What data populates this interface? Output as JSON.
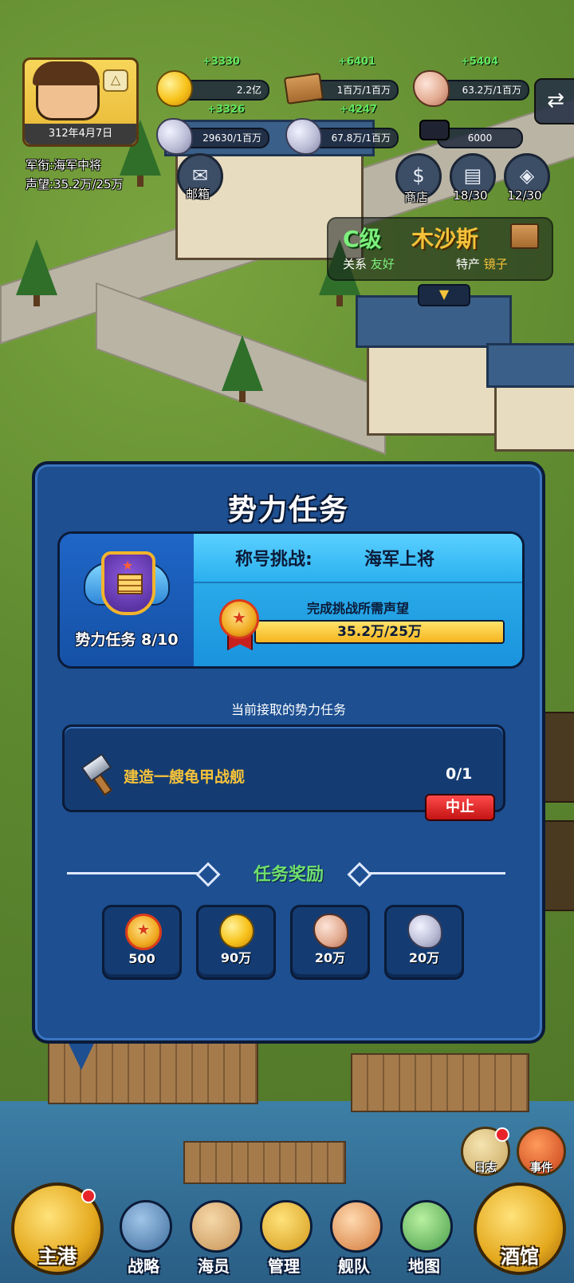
{
  "player": {
    "date": "312年4月7日",
    "rank_line": "军衔:海军中将",
    "reputation_line": "声望:35.2万/25万"
  },
  "resources": {
    "gold": {
      "plus": "+3330",
      "value": "2.2亿",
      "icon": "gold-coin-icon"
    },
    "wood": {
      "plus": "+6401",
      "value": "1百万/1百万",
      "icon": "wood-plank-icon"
    },
    "pink_ore": {
      "plus": "+5404",
      "value": "63.2万/1百万",
      "icon": "pink-ore-icon"
    },
    "silver_ore": {
      "plus": "+3326",
      "value": "29630/1百万",
      "icon": "silver-ore-icon"
    },
    "gray_ore": {
      "plus": "+4247",
      "value": "67.8万/1百万",
      "icon": "gray-ore-icon"
    },
    "academy": {
      "value": "6000",
      "icon": "graduation-cap-icon"
    }
  },
  "top_buttons": {
    "mail": {
      "label": "邮箱",
      "icon": "mail-envelope-icon"
    },
    "shop": {
      "label": "商店",
      "icon": "money-bag-icon"
    },
    "book": {
      "label": "18/30",
      "icon": "book-icon"
    },
    "ticket": {
      "label": "12/30",
      "icon": "ticket-icon"
    }
  },
  "city": {
    "grade": "C级",
    "name": "木沙斯",
    "relation_label": "关系",
    "relation_value": "友好",
    "product_label": "特产",
    "product_value": "镜子"
  },
  "panel": {
    "title": "势力任务",
    "faction_count": "势力任务 8/10",
    "challenge_label": "称号挑战:",
    "challenge_target": "海军上将",
    "requirement_label": "完成挑战所需声望",
    "reputation_progress_text": "35.2万/25万",
    "reputation_progress_ratio": 1.0,
    "current_section": "当前接取的势力任务",
    "task": {
      "name": "建造一艘龟甲战舰",
      "progress": "0/1",
      "stop_label": "中止"
    },
    "reward_title": "任务奖励",
    "rewards": [
      {
        "amount": "500",
        "icon": "reputation-medal-icon"
      },
      {
        "amount": "90万",
        "icon": "gold-coin-icon"
      },
      {
        "amount": "20万",
        "icon": "pink-ore-icon"
      },
      {
        "amount": "20万",
        "icon": "silver-ore-icon"
      }
    ]
  },
  "side_buttons": {
    "log": {
      "label": "日志"
    },
    "event": {
      "label": "事件"
    }
  },
  "nav": {
    "home": {
      "label": "主港"
    },
    "strategy": {
      "label": "战略"
    },
    "sailors": {
      "label": "海员"
    },
    "manage": {
      "label": "管理"
    },
    "fleet": {
      "label": "舰队"
    },
    "map": {
      "label": "地图"
    },
    "tavern": {
      "label": "酒馆"
    }
  },
  "colors": {
    "panel_bg": "#1d4f91",
    "panel_border": "#0b1b38",
    "accent_yellow": "#f5c23a",
    "accent_green": "#6fe06f",
    "stop_red": "#c41414"
  }
}
